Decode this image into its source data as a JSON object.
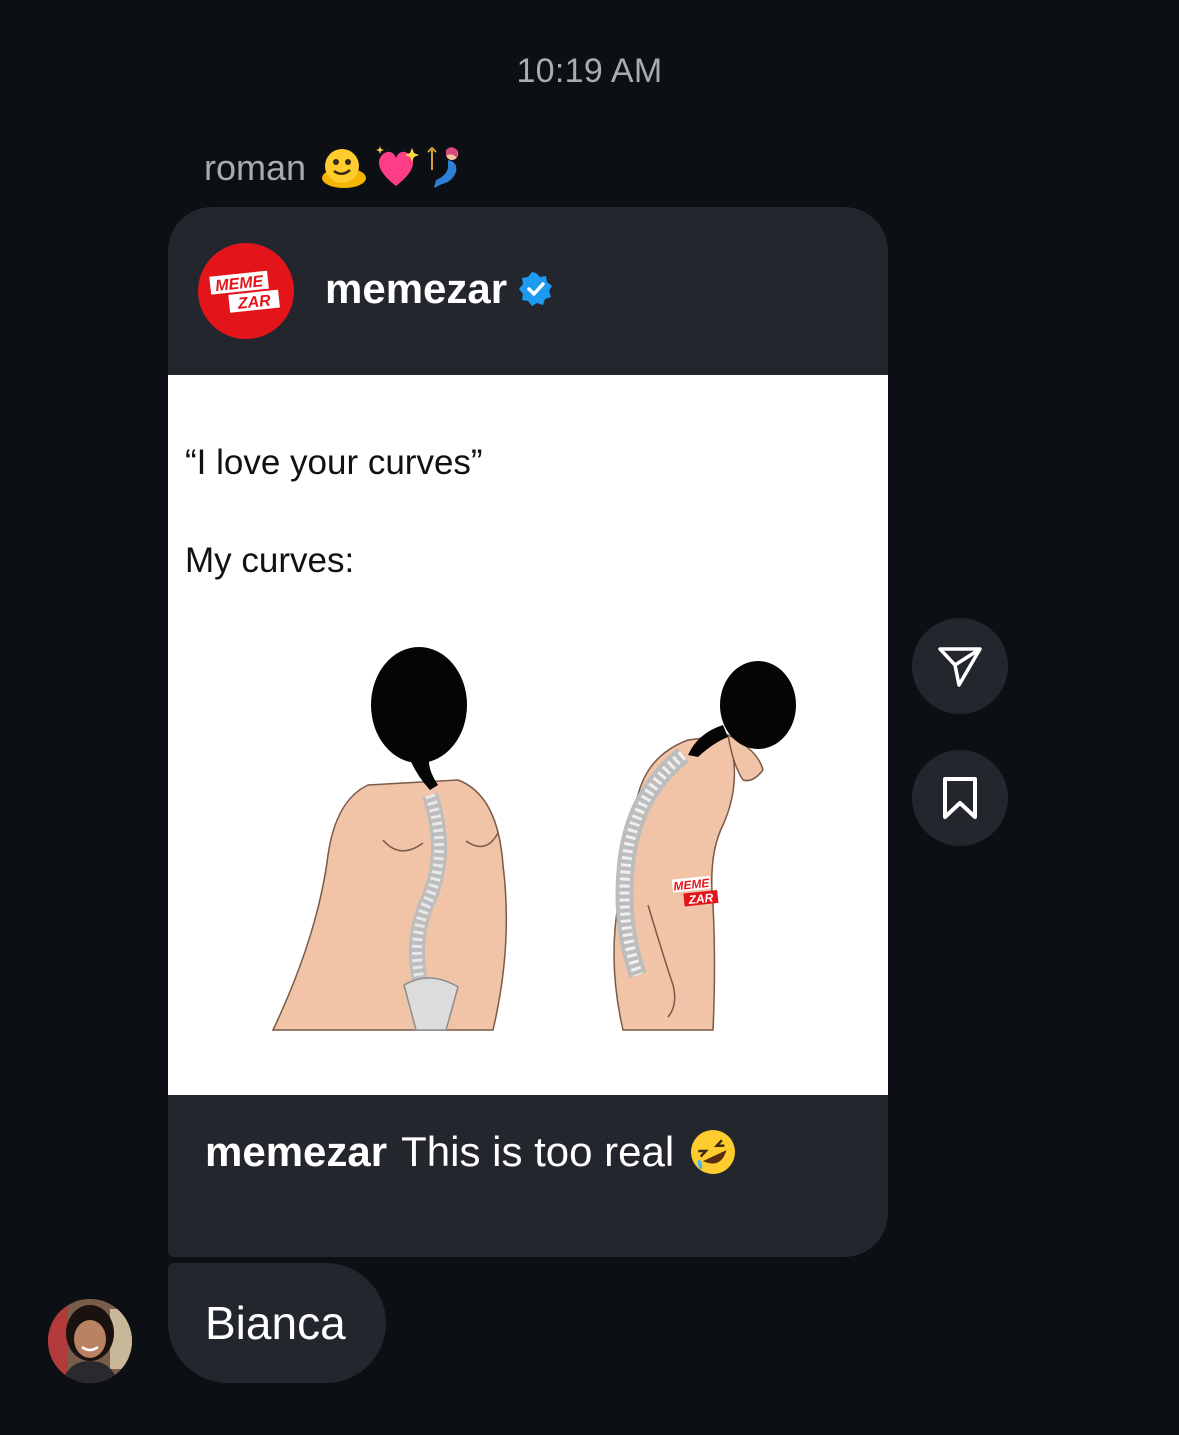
{
  "chat": {
    "timestamp": "10:19 AM",
    "sender": {
      "name": "roman",
      "emojis": [
        "melting-face",
        "sparkling-heart",
        "mermaid"
      ]
    },
    "shared_post": {
      "author": "memezar",
      "verified": true,
      "avatar_text_line1": "MEME",
      "avatar_text_line2": "ZAR",
      "brand_color": "#e3151b",
      "verified_color": "#1d9bf0",
      "image": {
        "line1": "“I love your curves”",
        "line2": "My curves:",
        "watermark_line1": "MEME",
        "watermark_line2": "ZAR"
      },
      "caption_user": "memezar",
      "caption_text": "This is too real",
      "caption_emoji": "rolling-on-floor-laughing"
    },
    "actions": {
      "share_icon": "paper-plane-icon",
      "save_icon": "bookmark-icon"
    },
    "reply": {
      "text": "Bianca"
    }
  }
}
